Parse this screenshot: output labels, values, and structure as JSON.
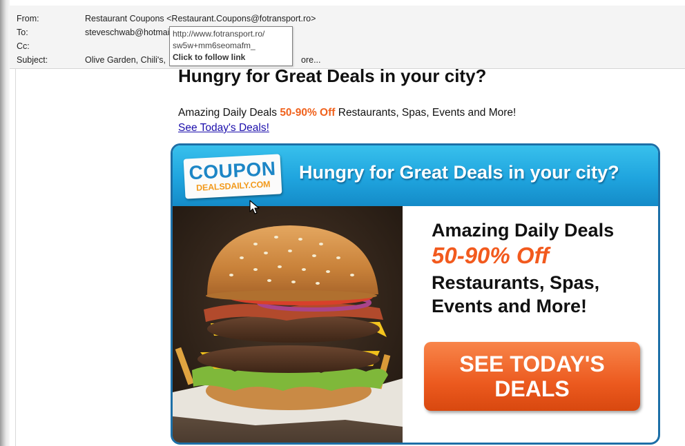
{
  "email_header": {
    "from_label": "From:",
    "from_value": "Restaurant Coupons <Restaurant.Coupons@fotransport.ro>",
    "to_label": "To:",
    "to_value": "steveschwab@hotmail.",
    "cc_label": "Cc:",
    "cc_value": "",
    "subject_label": "Subject:",
    "subject_value_start": "Olive Garden, Chili's,",
    "subject_value_end": "ore..."
  },
  "tooltip": {
    "url_line1": "http://www.fotransport.ro/",
    "url_line2": "sw5w+mm6seomafm_",
    "hint": "Click to follow link"
  },
  "email_body": {
    "headline": "Hungry for Great Deals in your city?",
    "tagline_before": "Amazing Daily Deals ",
    "tagline_discount": "50-90% Off",
    "tagline_after": " Restaurants, Spas, Events and More!",
    "link_text": "See Today's Deals!"
  },
  "banner": {
    "logo_main": "COUPON",
    "logo_sub": "DEALSDAILY.COM",
    "headline": "Hungry for Great Deals in your city?",
    "line1": "Amazing Daily Deals",
    "line2": "50-90% Off",
    "line3": "Restaurants, Spas,",
    "line4": "Events and More!",
    "cta_line1": "SEE TODAY'S",
    "cta_line2": "DEALS"
  },
  "colors": {
    "discount_orange": "#f0621d",
    "banner_blue": "#1fa4de",
    "cta_orange": "#ec5a1f",
    "link_blue": "#1a0dab"
  },
  "icons": {
    "cursor": "arrow-cursor-icon",
    "burger": "burger-image"
  }
}
